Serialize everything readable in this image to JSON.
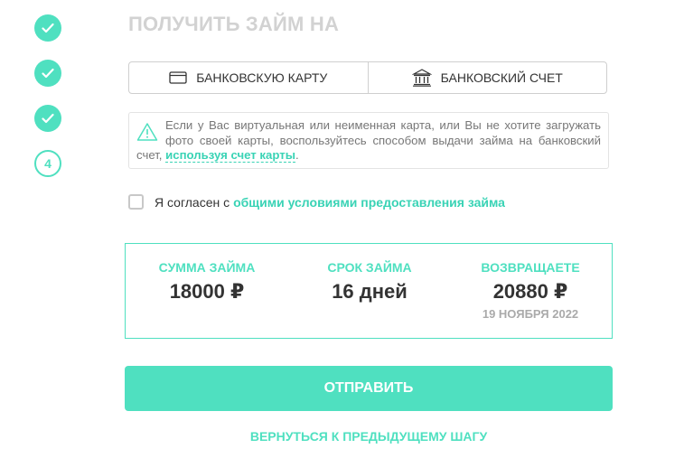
{
  "steps": [
    {
      "state": "done",
      "icon": "check-icon"
    },
    {
      "state": "done",
      "icon": "check-icon"
    },
    {
      "state": "done",
      "icon": "check-icon"
    },
    {
      "state": "current",
      "number": "4"
    }
  ],
  "title": "ПОЛУЧИТЬ ЗАЙМ НА",
  "tabs": {
    "card": {
      "label": "БАНКОВСКУЮ КАРТУ",
      "icon": "credit-card-icon"
    },
    "account": {
      "label": "БАНКОВСКИЙ СЧЕТ",
      "icon": "bank-icon"
    }
  },
  "notice": {
    "icon": "warning-icon",
    "text": "Если у Вас виртуальная или неименная карта, или Вы не хотите загружать фото своей карты, воспользуйтесь способом выдачи займа на банковский счет,",
    "link": "используя счет карты",
    "suffix": "."
  },
  "agree": {
    "text": "Я согласен с",
    "link": "общими условиями предоставления займа",
    "checked": false
  },
  "summary": {
    "amount": {
      "label": "СУММА ЗАЙМА",
      "value": "18000 ₽"
    },
    "term": {
      "label": "СРОК ЗАЙМА",
      "value": "16 дней"
    },
    "return": {
      "label": "ВОЗВРАЩАЕТЕ",
      "value": "20880 ₽",
      "date": "19 НОЯБРЯ 2022"
    }
  },
  "submit_label": "ОТПРАВИТЬ",
  "back_label": "ВЕРНУТЬСЯ К ПРЕДЫДУЩЕМУ ШАГУ",
  "colors": {
    "accent": "#4fe0c0",
    "link": "#39d3b5"
  }
}
